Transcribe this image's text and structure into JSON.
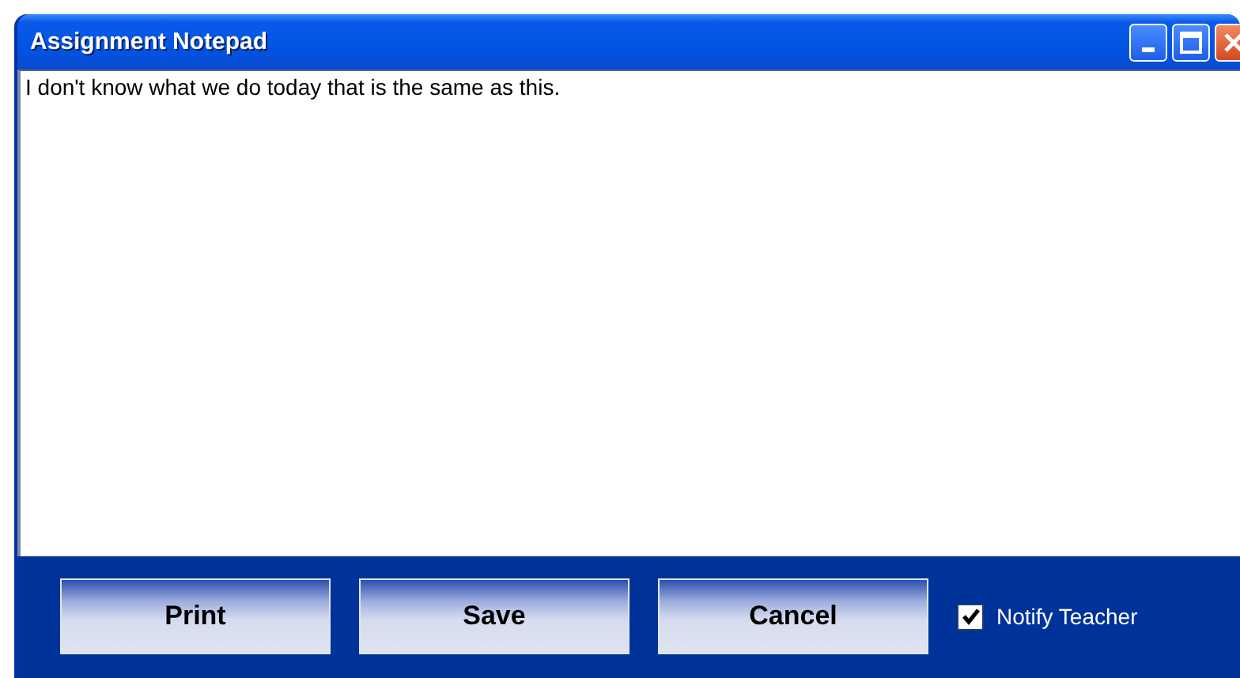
{
  "window": {
    "title": "Assignment Notepad"
  },
  "editor": {
    "value": "I don't know what we do today that is the same as this."
  },
  "buttons": [
    {
      "label": "Print"
    },
    {
      "label": "Save"
    },
    {
      "label": "Cancel"
    }
  ],
  "notify": {
    "label": "Notify Teacher",
    "checked": true
  }
}
